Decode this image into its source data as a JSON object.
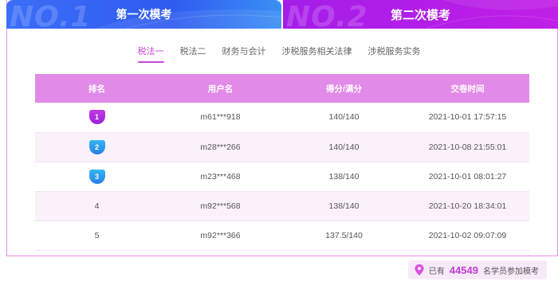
{
  "exam_tabs": [
    {
      "label": "第一次模考",
      "ghost": "NO.1",
      "active": false
    },
    {
      "label": "第二次模考",
      "ghost": "NO.2",
      "active": true
    }
  ],
  "subjects": [
    {
      "label": "税法一",
      "active": true
    },
    {
      "label": "税法二",
      "active": false
    },
    {
      "label": "财务与会计",
      "active": false
    },
    {
      "label": "涉税服务相关法律",
      "active": false
    },
    {
      "label": "涉税服务实务",
      "active": false
    }
  ],
  "table": {
    "headers": [
      "排名",
      "用户名",
      "得分/满分",
      "交卷时间"
    ],
    "rows": [
      {
        "rank": "1",
        "medal": "purple",
        "user": "m61***918",
        "score": "140/140",
        "time": "2021-10-01 17:57:15"
      },
      {
        "rank": "2",
        "medal": "blue",
        "user": "m28***266",
        "score": "140/140",
        "time": "2021-10-08 21:55:01"
      },
      {
        "rank": "3",
        "medal": "blue",
        "user": "m23***468",
        "score": "138/140",
        "time": "2021-10-01 08:01:27"
      },
      {
        "rank": "4",
        "medal": "",
        "user": "m92***568",
        "score": "138/140",
        "time": "2021-10-20 18:34:01"
      },
      {
        "rank": "5",
        "medal": "",
        "user": "m92***366",
        "score": "137.5/140",
        "time": "2021-10-02 09:07:09"
      }
    ]
  },
  "footer": {
    "prefix": "已有",
    "count": "44549",
    "suffix": "名学员参加模考",
    "icon": "location-pin-icon"
  },
  "colors": {
    "tab1": "#2f5bf0",
    "tab2": "#b01ee8",
    "header_row": "#e28ae8",
    "accent": "#c84ad8",
    "count": "#c23bd6"
  }
}
